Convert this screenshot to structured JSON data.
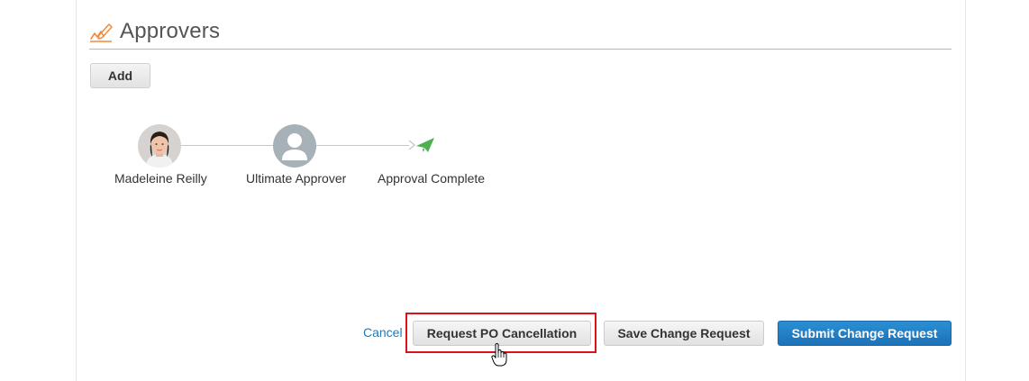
{
  "section": {
    "title": "Approvers",
    "icon": "approvers-signature-icon",
    "accent_color": "#f08a3c"
  },
  "add_button": {
    "label": "Add"
  },
  "approval_flow": {
    "steps": [
      {
        "label": "Madeleine Reilly",
        "icon": "user-photo-avatar"
      },
      {
        "label": "Ultimate Approver",
        "icon": "generic-user-avatar-icon"
      },
      {
        "label": "Approval Complete",
        "icon": "paper-plane-icon",
        "icon_color": "#4caf50"
      }
    ]
  },
  "footer": {
    "cancel_label": "Cancel",
    "request_cancellation_label": "Request PO Cancellation",
    "save_change_label": "Save Change Request",
    "submit_change_label": "Submit Change Request",
    "link_color": "#1a7bbf",
    "primary_color": "#2281c4",
    "highlight_color": "#d9131a"
  }
}
